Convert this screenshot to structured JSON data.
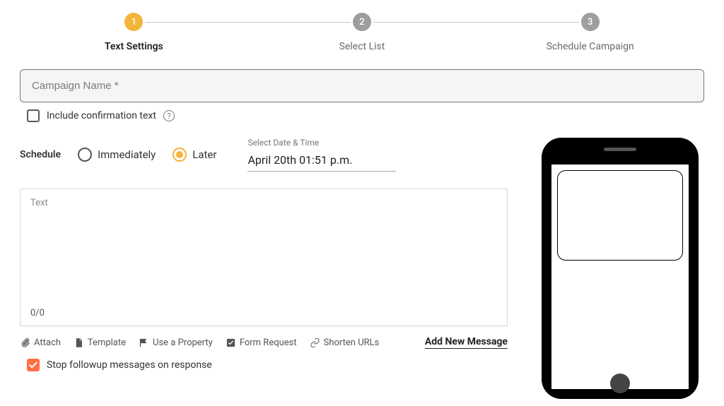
{
  "stepper": {
    "steps": [
      {
        "num": "1",
        "label": "Text Settings"
      },
      {
        "num": "2",
        "label": "Select List"
      },
      {
        "num": "3",
        "label": "Schedule Campaign"
      }
    ],
    "active_index": 0
  },
  "campaign_name": {
    "placeholder": "Campaign Name *",
    "value": ""
  },
  "confirmation": {
    "label": "Include confirmation text",
    "checked": false
  },
  "schedule": {
    "label": "Schedule",
    "options": {
      "immediately": "Immediately",
      "later": "Later"
    },
    "selected": "later",
    "datetime_label": "Select Date & Time",
    "datetime_value": "April 20th 01:51 p.m."
  },
  "text_area": {
    "placeholder": "Text",
    "counter": "0/0"
  },
  "actions": {
    "attach": "Attach",
    "template": "Template",
    "use_property": "Use a Property",
    "form_request": "Form Request",
    "shorten_urls": "Shorten URLs",
    "add_new_message": "Add New Message"
  },
  "followup": {
    "label": "Stop followup messages on response",
    "checked": true
  }
}
